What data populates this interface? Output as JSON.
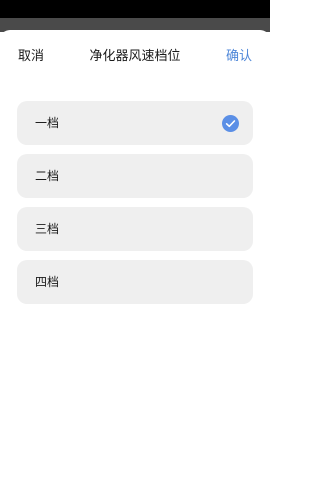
{
  "header": {
    "cancel_label": "取消",
    "title": "净化器风速档位",
    "confirm_label": "确认"
  },
  "options": [
    {
      "label": "一档",
      "selected": true
    },
    {
      "label": "二档",
      "selected": false
    },
    {
      "label": "三档",
      "selected": false
    },
    {
      "label": "四档",
      "selected": false
    }
  ],
  "colors": {
    "accent": "#4d86d8",
    "check_fill": "#5b8fe6",
    "option_bg": "#efefef",
    "status_bar": "#000000",
    "dim_overlay": "#4a4a4a"
  }
}
